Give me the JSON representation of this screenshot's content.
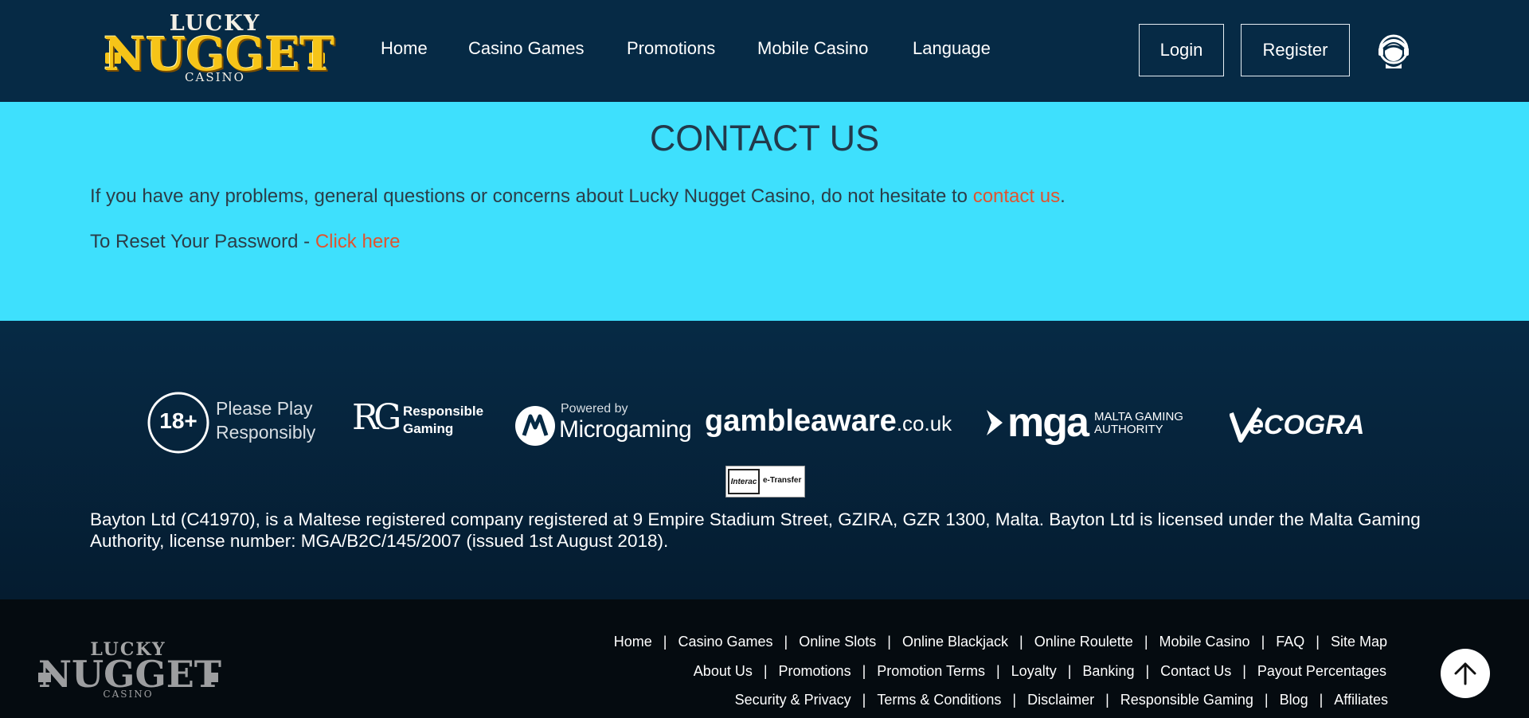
{
  "header": {
    "logo": {
      "top": "LUCKY",
      "main": "NUGGET",
      "bottom": "CASINO"
    },
    "nav": [
      "Home",
      "Casino Games",
      "Promotions",
      "Mobile Casino",
      "Language"
    ],
    "login_label": "Login",
    "register_label": "Register",
    "support_icon": "headset-support-icon"
  },
  "contact": {
    "title": "CONTACT US",
    "line1_text": "If you have any problems, general questions or concerns about Lucky Nugget Casino, do not hesitate to ",
    "line1_link": "contact us",
    "line1_end": ".",
    "line2_text": "To Reset Your Password - ",
    "line2_link": "Click here",
    "accent_color": "#3ee0fd",
    "link_color": "#e0542f"
  },
  "badges": {
    "age": "18+",
    "please_play": "Please Play",
    "responsibly": "Responsibly",
    "rg_mark": "RG",
    "rg_line1": "Responsible",
    "rg_line2": "Gaming",
    "micro_powered": "Powered by",
    "micro_name": "Microgaming",
    "gamble_bold": "gamble",
    "gamble_light": "aware",
    "gamble_tld": ".co.uk",
    "mga_mark": "mga",
    "mga_line1": "MALTA GAMING",
    "mga_line2": "AUTHORITY",
    "ecogra": "eCOGRA",
    "interac_left": "Interac",
    "interac_right": "e-Transfer"
  },
  "legal": "Bayton Ltd (C41970), is a Maltese registered company registered at 9 Empire Stadium Street, GZIRA, GZR 1300, Malta. Bayton Ltd is licensed under the Malta Gaming Authority, license number: MGA/B2C/145/2007 (issued 1st August 2018).",
  "footer": {
    "logo": {
      "top": "LUCKY",
      "main": "NUGGET",
      "bottom": "CASINO"
    },
    "row1": [
      "Home",
      "Casino Games",
      "Online Slots",
      "Online Blackjack",
      "Online Roulette",
      "Mobile Casino",
      "FAQ",
      "Site Map"
    ],
    "row2": [
      "About Us",
      "Promotions",
      "Promotion Terms",
      "Loyalty",
      "Banking",
      "Contact Us",
      "Payout Percentages"
    ],
    "row3": [
      "Security & Privacy",
      "Terms & Conditions",
      "Disclaimer",
      "Responsible Gaming",
      "Blog",
      "Affiliates"
    ],
    "separator": "|",
    "totop_icon": "arrow-up-icon"
  }
}
